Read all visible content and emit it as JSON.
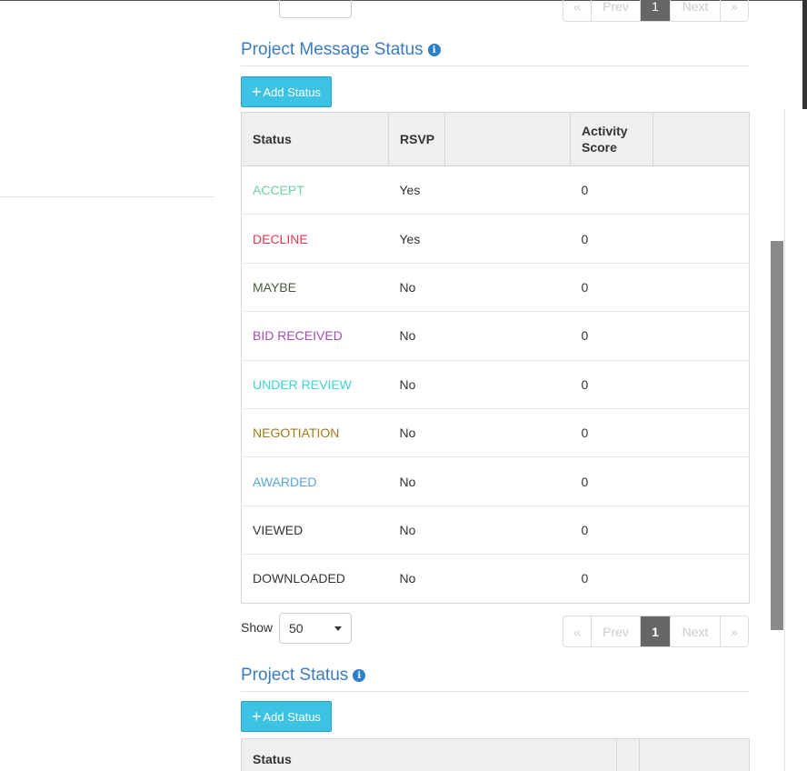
{
  "top_pager": {
    "first": "«",
    "prev": "Prev",
    "page": "1",
    "next": "Next",
    "last": "»"
  },
  "message_status": {
    "title": "Project Message Status",
    "info_icon": "i",
    "add_button": {
      "icon": "+",
      "label": "Add Status"
    },
    "headers": [
      "Status",
      "RSVP",
      "",
      "Activity Score",
      ""
    ],
    "rows": [
      {
        "status": "ACCEPT",
        "color": "#6fd0a0",
        "rsvp": "Yes",
        "score": "0"
      },
      {
        "status": "DECLINE",
        "color": "#e0364f",
        "rsvp": "Yes",
        "score": "0"
      },
      {
        "status": "MAYBE",
        "color": "#4a5a3a",
        "rsvp": "No",
        "score": "0"
      },
      {
        "status": "BID RECEIVED",
        "color": "#a24fb0",
        "rsvp": "No",
        "score": "0"
      },
      {
        "status": "UNDER REVIEW",
        "color": "#3ed4cf",
        "rsvp": "No",
        "score": "0"
      },
      {
        "status": "NEGOTIATION",
        "color": "#a07a1a",
        "rsvp": "No",
        "score": "0"
      },
      {
        "status": "AWARDED",
        "color": "#58a6d6",
        "rsvp": "No",
        "score": "0"
      },
      {
        "status": "VIEWED",
        "color": "#333333",
        "rsvp": "No",
        "score": "0"
      },
      {
        "status": "DOWNLOADED",
        "color": "#333333",
        "rsvp": "No",
        "score": "0"
      }
    ],
    "show_label": "Show",
    "page_size": "50",
    "pager": {
      "first": "«",
      "prev": "Prev",
      "page": "1",
      "next": "Next",
      "last": "»"
    }
  },
  "project_status": {
    "title": "Project Status",
    "info_icon": "i",
    "add_button": {
      "icon": "+",
      "label": "Add Status"
    },
    "headers": [
      "Status",
      "",
      ""
    ]
  }
}
